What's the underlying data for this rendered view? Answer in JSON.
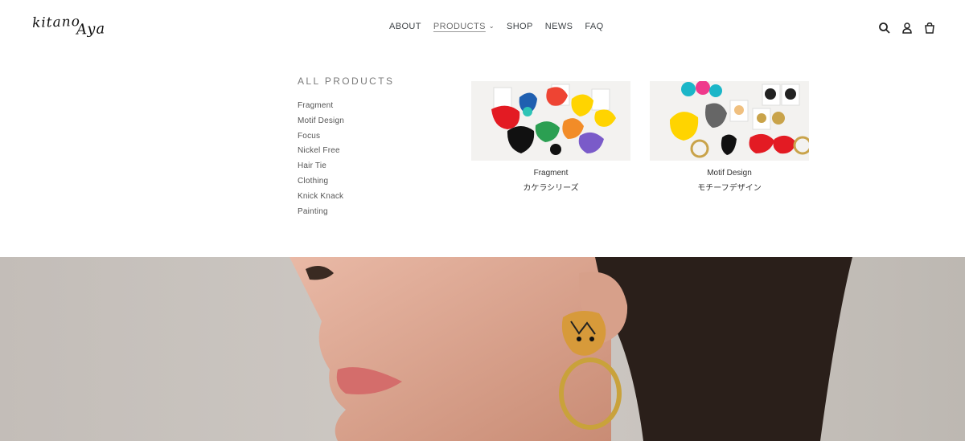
{
  "brand": {
    "logo_line1": "kitano",
    "logo_line2": "Aya"
  },
  "nav": {
    "items": [
      {
        "label": "ABOUT"
      },
      {
        "label": "PRODUCTS",
        "active": true
      },
      {
        "label": "SHOP"
      },
      {
        "label": "NEWS"
      },
      {
        "label": "FAQ"
      }
    ]
  },
  "header_icons": [
    "search-icon",
    "account-icon",
    "cart-icon"
  ],
  "mega_menu": {
    "title": "ALL PRODUCTS",
    "links": [
      "Fragment",
      "Motif Design",
      "Focus",
      "Nickel Free",
      "Hair Tie",
      "Clothing",
      "Knick Knack",
      "Painting"
    ],
    "featured": [
      {
        "name": "Fragment",
        "subtitle": "カケラシリーズ"
      },
      {
        "name": "Motif Design",
        "subtitle": "モチーフデザイン"
      }
    ]
  },
  "colors": {
    "accent": "#3d4246",
    "hero_bg": "#c9c4bf"
  }
}
